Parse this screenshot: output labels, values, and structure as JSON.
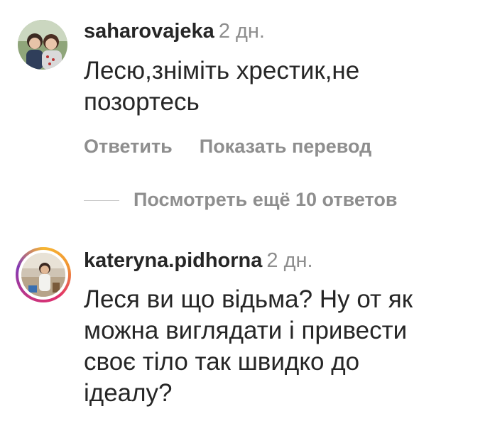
{
  "comments": [
    {
      "username": "saharovajeka",
      "time": "2 дн.",
      "text_lines": [
        "Лесю,зніміть хрестик,не",
        "позортесь"
      ],
      "reply_label": "Ответить",
      "translate_label": "Показать перевод"
    },
    {
      "username": "kateryna.pidhorna",
      "time": "2 дн.",
      "text_lines": [
        "Леся ви що відьма? Ну от як",
        "можна виглядати і привести",
        "своє тіло так швидко до",
        "ідеалу?"
      ]
    }
  ],
  "more_replies": {
    "label": "Посмотреть ещё 10 ответов"
  },
  "colors": {
    "text": "#262626",
    "secondary": "#8e8e8e",
    "story_ring_start": "#f7b733",
    "story_ring_mid": "#e1306c",
    "story_ring_end": "#c13584"
  }
}
